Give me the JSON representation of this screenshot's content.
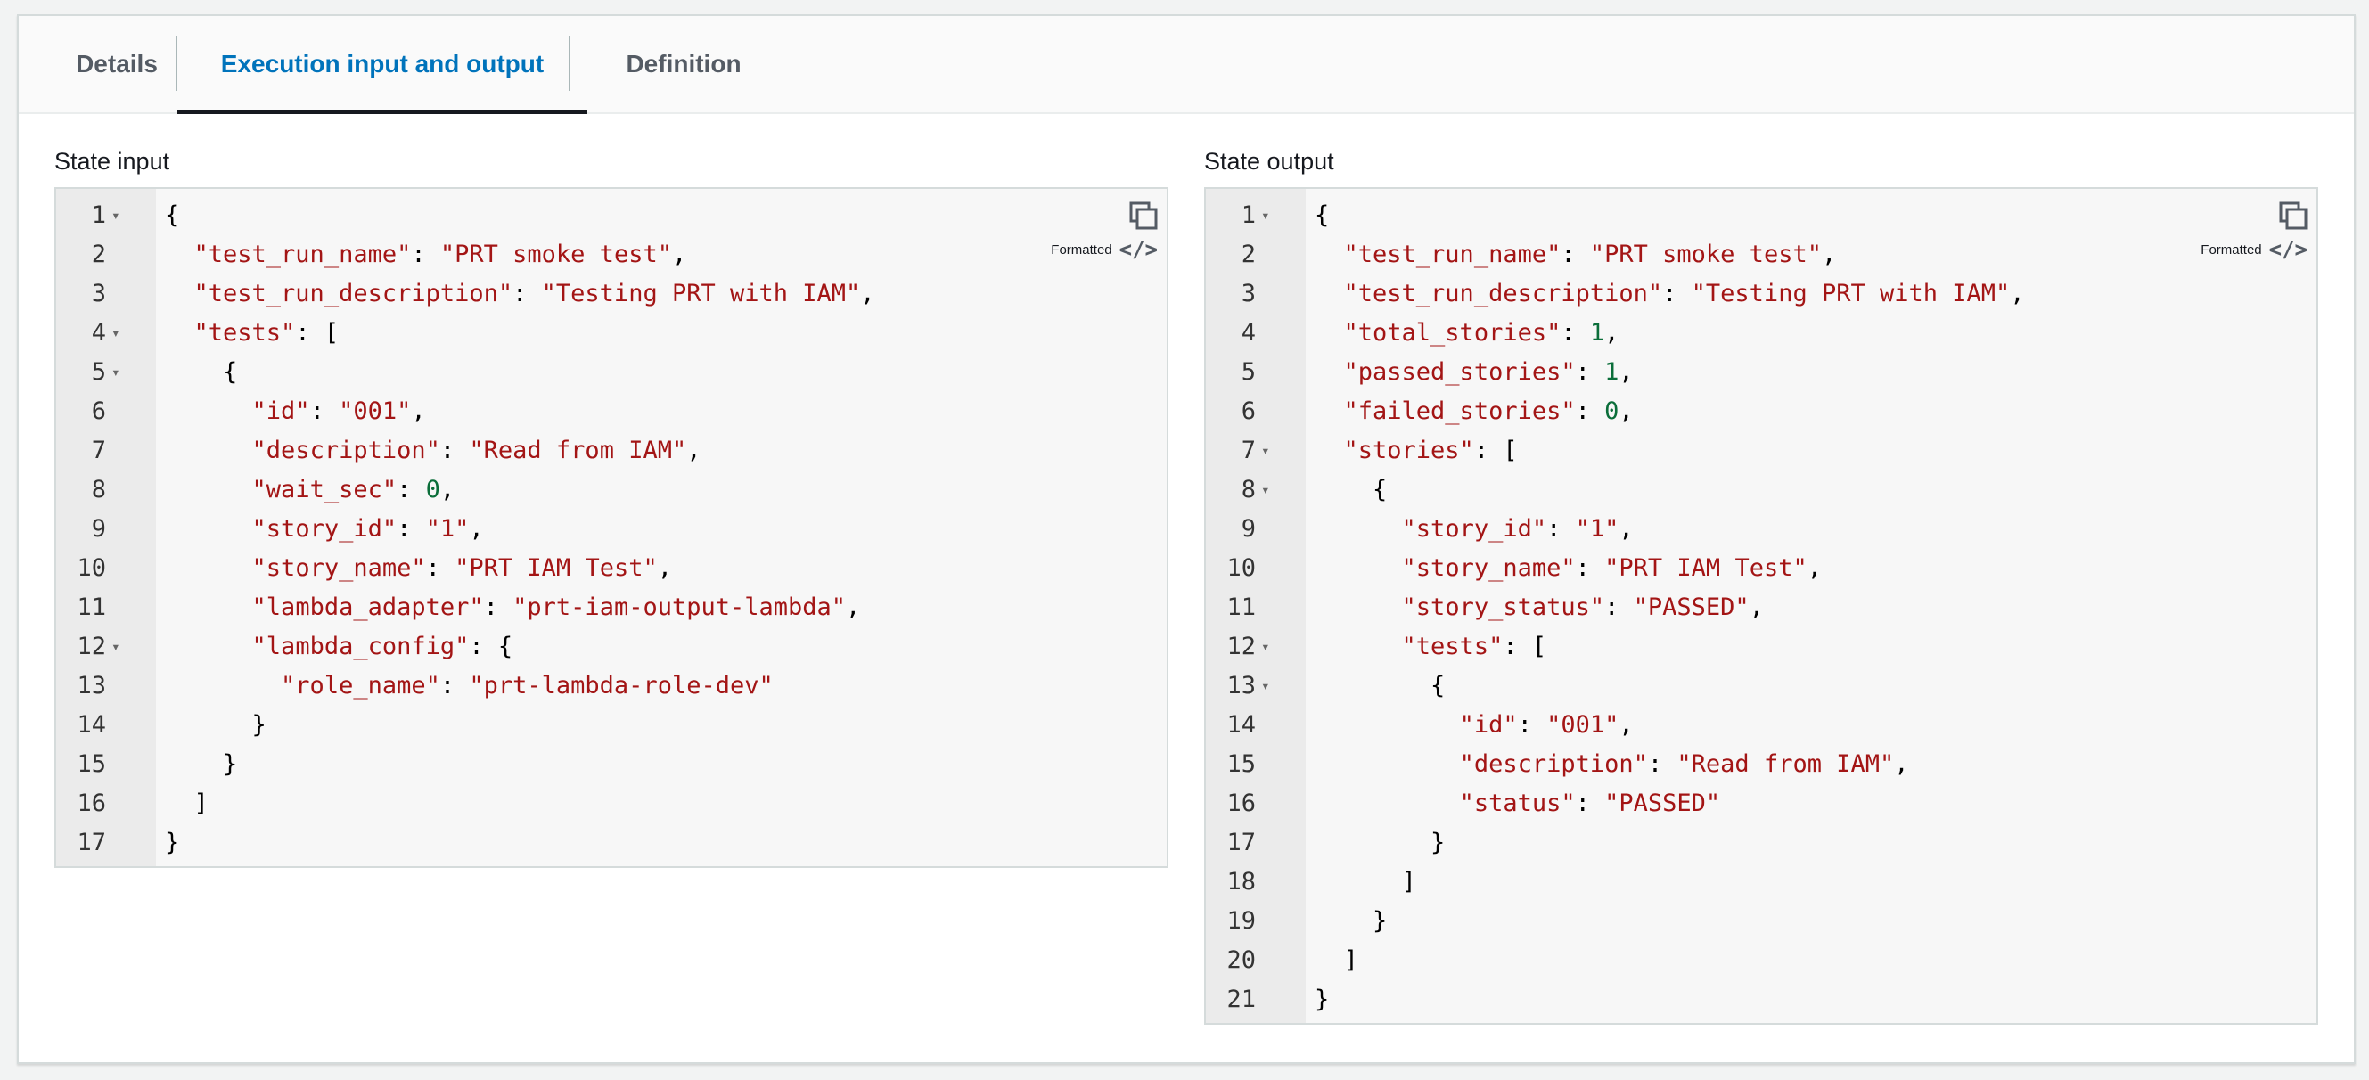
{
  "tabs": [
    {
      "label": "Details",
      "active": false
    },
    {
      "label": "Execution input and output",
      "active": true
    },
    {
      "label": "Definition",
      "active": false
    }
  ],
  "state_input": {
    "label": "State input",
    "formatted_label": "Formatted",
    "lines": [
      {
        "n": "1",
        "fold": true,
        "tokens": [
          [
            "p",
            "{"
          ]
        ]
      },
      {
        "n": "2",
        "fold": false,
        "tokens": [
          [
            "p",
            "  "
          ],
          [
            "k",
            "\"test_run_name\""
          ],
          [
            "p",
            ": "
          ],
          [
            "s",
            "\"PRT smoke test\""
          ],
          [
            "p",
            ","
          ]
        ]
      },
      {
        "n": "3",
        "fold": false,
        "tokens": [
          [
            "p",
            "  "
          ],
          [
            "k",
            "\"test_run_description\""
          ],
          [
            "p",
            ": "
          ],
          [
            "s",
            "\"Testing PRT with IAM\""
          ],
          [
            "p",
            ","
          ]
        ]
      },
      {
        "n": "4",
        "fold": true,
        "tokens": [
          [
            "p",
            "  "
          ],
          [
            "k",
            "\"tests\""
          ],
          [
            "p",
            ": ["
          ]
        ]
      },
      {
        "n": "5",
        "fold": true,
        "tokens": [
          [
            "p",
            "    {"
          ]
        ]
      },
      {
        "n": "6",
        "fold": false,
        "tokens": [
          [
            "p",
            "      "
          ],
          [
            "k",
            "\"id\""
          ],
          [
            "p",
            ": "
          ],
          [
            "s",
            "\"001\""
          ],
          [
            "p",
            ","
          ]
        ]
      },
      {
        "n": "7",
        "fold": false,
        "tokens": [
          [
            "p",
            "      "
          ],
          [
            "k",
            "\"description\""
          ],
          [
            "p",
            ": "
          ],
          [
            "s",
            "\"Read from IAM\""
          ],
          [
            "p",
            ","
          ]
        ]
      },
      {
        "n": "8",
        "fold": false,
        "tokens": [
          [
            "p",
            "      "
          ],
          [
            "k",
            "\"wait_sec\""
          ],
          [
            "p",
            ": "
          ],
          [
            "n",
            "0"
          ],
          [
            "p",
            ","
          ]
        ]
      },
      {
        "n": "9",
        "fold": false,
        "tokens": [
          [
            "p",
            "      "
          ],
          [
            "k",
            "\"story_id\""
          ],
          [
            "p",
            ": "
          ],
          [
            "s",
            "\"1\""
          ],
          [
            "p",
            ","
          ]
        ]
      },
      {
        "n": "10",
        "fold": false,
        "tokens": [
          [
            "p",
            "      "
          ],
          [
            "k",
            "\"story_name\""
          ],
          [
            "p",
            ": "
          ],
          [
            "s",
            "\"PRT IAM Test\""
          ],
          [
            "p",
            ","
          ]
        ]
      },
      {
        "n": "11",
        "fold": false,
        "tokens": [
          [
            "p",
            "      "
          ],
          [
            "k",
            "\"lambda_adapter\""
          ],
          [
            "p",
            ": "
          ],
          [
            "s",
            "\"prt-iam-output-lambda\""
          ],
          [
            "p",
            ","
          ]
        ]
      },
      {
        "n": "12",
        "fold": true,
        "tokens": [
          [
            "p",
            "      "
          ],
          [
            "k",
            "\"lambda_config\""
          ],
          [
            "p",
            ": {"
          ]
        ]
      },
      {
        "n": "13",
        "fold": false,
        "tokens": [
          [
            "p",
            "        "
          ],
          [
            "k",
            "\"role_name\""
          ],
          [
            "p",
            ": "
          ],
          [
            "s",
            "\"prt-lambda-role-dev\""
          ]
        ]
      },
      {
        "n": "14",
        "fold": false,
        "tokens": [
          [
            "p",
            "      }"
          ]
        ]
      },
      {
        "n": "15",
        "fold": false,
        "tokens": [
          [
            "p",
            "    }"
          ]
        ]
      },
      {
        "n": "16",
        "fold": false,
        "tokens": [
          [
            "p",
            "  ]"
          ]
        ]
      },
      {
        "n": "17",
        "fold": false,
        "tokens": [
          [
            "p",
            "}"
          ]
        ]
      }
    ]
  },
  "state_output": {
    "label": "State output",
    "formatted_label": "Formatted",
    "lines": [
      {
        "n": "1",
        "fold": true,
        "tokens": [
          [
            "p",
            "{"
          ]
        ]
      },
      {
        "n": "2",
        "fold": false,
        "tokens": [
          [
            "p",
            "  "
          ],
          [
            "k",
            "\"test_run_name\""
          ],
          [
            "p",
            ": "
          ],
          [
            "s",
            "\"PRT smoke test\""
          ],
          [
            "p",
            ","
          ]
        ]
      },
      {
        "n": "3",
        "fold": false,
        "tokens": [
          [
            "p",
            "  "
          ],
          [
            "k",
            "\"test_run_description\""
          ],
          [
            "p",
            ": "
          ],
          [
            "s",
            "\"Testing PRT with IAM\""
          ],
          [
            "p",
            ","
          ]
        ]
      },
      {
        "n": "4",
        "fold": false,
        "tokens": [
          [
            "p",
            "  "
          ],
          [
            "k",
            "\"total_stories\""
          ],
          [
            "p",
            ": "
          ],
          [
            "n",
            "1"
          ],
          [
            "p",
            ","
          ]
        ]
      },
      {
        "n": "5",
        "fold": false,
        "tokens": [
          [
            "p",
            "  "
          ],
          [
            "k",
            "\"passed_stories\""
          ],
          [
            "p",
            ": "
          ],
          [
            "n",
            "1"
          ],
          [
            "p",
            ","
          ]
        ]
      },
      {
        "n": "6",
        "fold": false,
        "tokens": [
          [
            "p",
            "  "
          ],
          [
            "k",
            "\"failed_stories\""
          ],
          [
            "p",
            ": "
          ],
          [
            "n",
            "0"
          ],
          [
            "p",
            ","
          ]
        ]
      },
      {
        "n": "7",
        "fold": true,
        "tokens": [
          [
            "p",
            "  "
          ],
          [
            "k",
            "\"stories\""
          ],
          [
            "p",
            ": ["
          ]
        ]
      },
      {
        "n": "8",
        "fold": true,
        "tokens": [
          [
            "p",
            "    {"
          ]
        ]
      },
      {
        "n": "9",
        "fold": false,
        "tokens": [
          [
            "p",
            "      "
          ],
          [
            "k",
            "\"story_id\""
          ],
          [
            "p",
            ": "
          ],
          [
            "s",
            "\"1\""
          ],
          [
            "p",
            ","
          ]
        ]
      },
      {
        "n": "10",
        "fold": false,
        "tokens": [
          [
            "p",
            "      "
          ],
          [
            "k",
            "\"story_name\""
          ],
          [
            "p",
            ": "
          ],
          [
            "s",
            "\"PRT IAM Test\""
          ],
          [
            "p",
            ","
          ]
        ]
      },
      {
        "n": "11",
        "fold": false,
        "tokens": [
          [
            "p",
            "      "
          ],
          [
            "k",
            "\"story_status\""
          ],
          [
            "p",
            ": "
          ],
          [
            "s",
            "\"PASSED\""
          ],
          [
            "p",
            ","
          ]
        ]
      },
      {
        "n": "12",
        "fold": true,
        "tokens": [
          [
            "p",
            "      "
          ],
          [
            "k",
            "\"tests\""
          ],
          [
            "p",
            ": ["
          ]
        ]
      },
      {
        "n": "13",
        "fold": true,
        "tokens": [
          [
            "p",
            "        {"
          ]
        ]
      },
      {
        "n": "14",
        "fold": false,
        "tokens": [
          [
            "p",
            "          "
          ],
          [
            "k",
            "\"id\""
          ],
          [
            "p",
            ": "
          ],
          [
            "s",
            "\"001\""
          ],
          [
            "p",
            ","
          ]
        ]
      },
      {
        "n": "15",
        "fold": false,
        "tokens": [
          [
            "p",
            "          "
          ],
          [
            "k",
            "\"description\""
          ],
          [
            "p",
            ": "
          ],
          [
            "s",
            "\"Read from IAM\""
          ],
          [
            "p",
            ","
          ]
        ]
      },
      {
        "n": "16",
        "fold": false,
        "tokens": [
          [
            "p",
            "          "
          ],
          [
            "k",
            "\"status\""
          ],
          [
            "p",
            ": "
          ],
          [
            "s",
            "\"PASSED\""
          ]
        ]
      },
      {
        "n": "17",
        "fold": false,
        "tokens": [
          [
            "p",
            "        }"
          ]
        ]
      },
      {
        "n": "18",
        "fold": false,
        "tokens": [
          [
            "p",
            "      ]"
          ]
        ]
      },
      {
        "n": "19",
        "fold": false,
        "tokens": [
          [
            "p",
            "    }"
          ]
        ]
      },
      {
        "n": "20",
        "fold": false,
        "tokens": [
          [
            "p",
            "  ]"
          ]
        ]
      },
      {
        "n": "21",
        "fold": false,
        "tokens": [
          [
            "p",
            "}"
          ]
        ]
      }
    ]
  },
  "icons": {
    "copy": "copy-icon",
    "code_view": "code-view-icon",
    "fold": "fold-arrow-icon"
  },
  "colors": {
    "active_tab": "#0073bb",
    "json_key_string": "#a31515",
    "json_number": "#0b6e3a"
  }
}
